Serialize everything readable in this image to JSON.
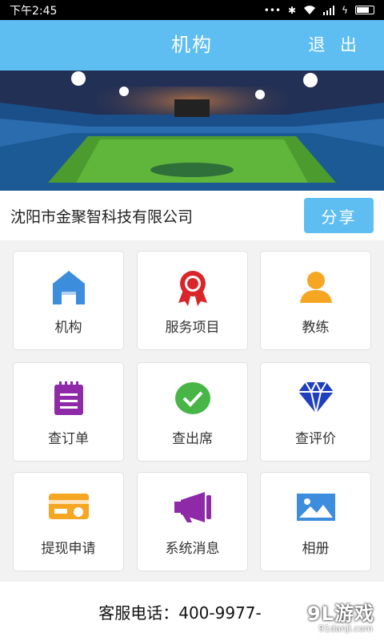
{
  "status": {
    "time": "下午2:45"
  },
  "header": {
    "title": "机构",
    "logout": "退 出"
  },
  "company": {
    "name": "沈阳市金聚智科技有限公司",
    "share": "分享"
  },
  "menu": [
    {
      "label": "机构",
      "icon": "building-icon"
    },
    {
      "label": "服务项目",
      "icon": "ribbon-award-icon"
    },
    {
      "label": "教练",
      "icon": "person-icon"
    },
    {
      "label": "查订单",
      "icon": "notepad-icon"
    },
    {
      "label": "查出席",
      "icon": "checkmark-circle-icon"
    },
    {
      "label": "查评价",
      "icon": "diamond-icon"
    },
    {
      "label": "提现申请",
      "icon": "card-icon"
    },
    {
      "label": "系统消息",
      "icon": "megaphone-icon"
    },
    {
      "label": "相册",
      "icon": "picture-icon"
    }
  ],
  "colors": {
    "accent": "#5ebef2",
    "blue": "#3c8ddc",
    "red": "#d8262b",
    "orange": "#f5a623",
    "purple": "#8e2aa8",
    "green": "#47b647",
    "navy": "#1f3fbf"
  },
  "footer": {
    "phone": "客服电话：400-9977-"
  },
  "watermark": {
    "logo": "9L游戏",
    "url": "91danji.com"
  }
}
